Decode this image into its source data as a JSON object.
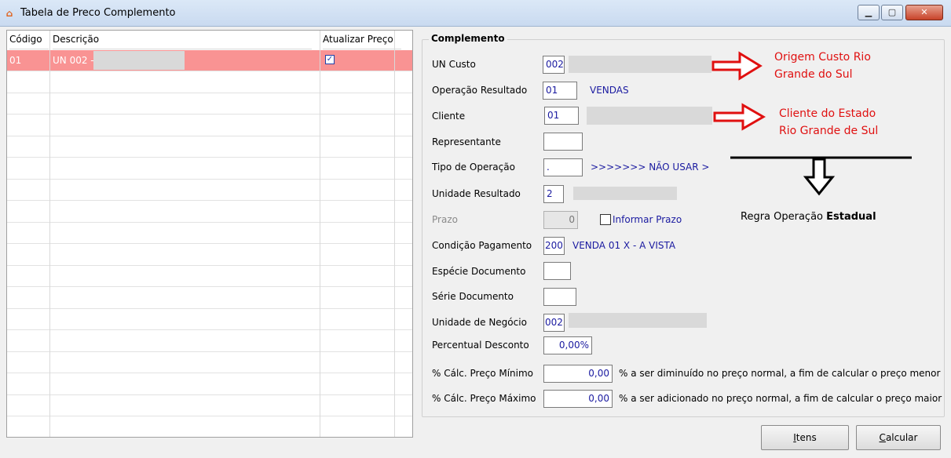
{
  "window": {
    "title": "Tabela de Preco Complemento",
    "icon": "app-icon"
  },
  "grid": {
    "columns": [
      "Código",
      "Descrição",
      "Atualizar Preço"
    ],
    "rows": [
      {
        "codigo": "01",
        "descricao": "UN 002 -",
        "atualizar": true
      }
    ]
  },
  "complemento": {
    "title": "Complemento",
    "un_custo": {
      "label": "UN Custo",
      "value": "002"
    },
    "operacao_resultado": {
      "label": "Operação Resultado",
      "value": "01",
      "desc": "VENDAS"
    },
    "cliente": {
      "label": "Cliente",
      "value": "01"
    },
    "representante": {
      "label": "Representante",
      "value": ""
    },
    "tipo_operacao": {
      "label": "Tipo de Operação",
      "value": ".",
      "desc": ">>>>>>> NÃO USAR >"
    },
    "unidade_resultado": {
      "label": "Unidade Resultado",
      "value": "2"
    },
    "prazo": {
      "label": "Prazo",
      "value": "0",
      "checkbox_label": "Informar Prazo"
    },
    "condicao_pagamento": {
      "label": "Condição Pagamento",
      "value": "200",
      "desc": "VENDA 01 X - A VISTA"
    },
    "especie_documento": {
      "label": "Espécie Documento",
      "value": ""
    },
    "serie_documento": {
      "label": "Série Documento",
      "value": ""
    },
    "unidade_negocio": {
      "label": "Unidade de Negócio",
      "value": "002"
    },
    "percentual_desconto": {
      "label": "Percentual Desconto",
      "value": "0,00%"
    },
    "preco_minimo": {
      "label": "% Cálc. Preço Mínimo",
      "value": "0,00",
      "hint": "% a ser diminuído no preço normal, a fim de calcular o preço menor"
    },
    "preco_maximo": {
      "label": "% Cálc. Preço Máximo",
      "value": "0,00",
      "hint": "% a ser adicionado no preço normal, a fim de calcular o preço maior"
    }
  },
  "annotations": {
    "origem_line1": "Origem Custo Rio",
    "origem_line2": "Grande do Sul",
    "cliente_line1": "Cliente do Estado",
    "cliente_line2": "Rio Grande de Sul",
    "regra_prefix": "Regra Operação ",
    "regra_bold": "Estadual"
  },
  "buttons": {
    "itens_first": "I",
    "itens_rest": "tens",
    "calcular_first": "C",
    "calcular_rest": "alcular"
  },
  "colors": {
    "selected_row": "#f99393",
    "annotation_red": "#e01010",
    "value_blue": "#1a1aa0"
  }
}
